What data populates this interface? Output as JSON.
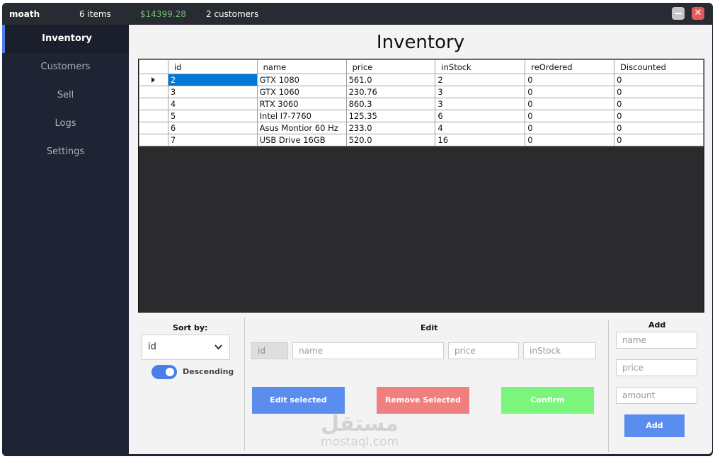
{
  "titlebar": {
    "user": "moath",
    "items_count": "6 items",
    "revenue": "$14399.28",
    "customers_count": "2 customers",
    "close_glyph": "✕"
  },
  "sidebar": {
    "items": [
      {
        "label": "Inventory",
        "active": true
      },
      {
        "label": "Customers",
        "active": false
      },
      {
        "label": "Sell",
        "active": false
      },
      {
        "label": "Logs",
        "active": false
      },
      {
        "label": "Settings",
        "active": false
      }
    ]
  },
  "main": {
    "title": "Inventory"
  },
  "grid": {
    "columns": [
      "id",
      "name",
      "price",
      "inStock",
      "reOrdered",
      "Discounted"
    ],
    "rows": [
      [
        "2",
        "GTX 1080",
        "561.0",
        "2",
        "0",
        "0"
      ],
      [
        "3",
        "GTX 1060",
        "230.76",
        "3",
        "0",
        "0"
      ],
      [
        "4",
        "RTX 3060",
        "860.3",
        "3",
        "0",
        "0"
      ],
      [
        "5",
        "Intel I7-7760",
        "125.35",
        "6",
        "0",
        "0"
      ],
      [
        "6",
        "Asus Montior 60 Hz",
        "233.0",
        "4",
        "0",
        "0"
      ],
      [
        "7",
        "USB Drive 16GB",
        "520.0",
        "16",
        "0",
        "0"
      ]
    ]
  },
  "sort": {
    "title": "Sort by:",
    "selected": "id",
    "descending_label": "Descending",
    "descending_on": true
  },
  "edit": {
    "title": "Edit",
    "id_placeholder": "id",
    "name_placeholder": "name",
    "price_placeholder": "price",
    "instock_placeholder": "inStock",
    "edit_label": "Edit selected",
    "remove_label": "Remove Selected",
    "confirm_label": "Confirm"
  },
  "add": {
    "title": "Add",
    "name_placeholder": "name",
    "price_placeholder": "price",
    "amount_placeholder": "amount",
    "add_label": "Add"
  },
  "watermark": {
    "arabic": "مستقل",
    "latin": "mostaql.com"
  },
  "colors": {
    "sidebar_bg": "#1e2433",
    "accent": "#4a7ee8",
    "selected_cell": "#0078d7",
    "edit_button": "#5b8def",
    "remove_button": "#f08080",
    "confirm_button": "#7cf57c",
    "revenue_text": "#6fbf73"
  }
}
